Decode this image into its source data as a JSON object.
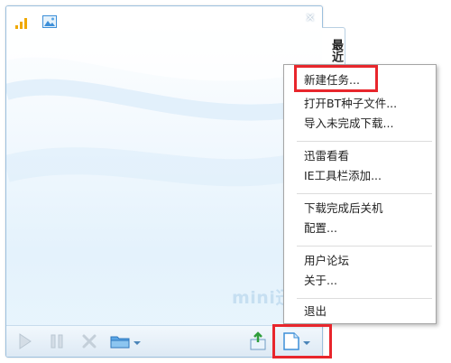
{
  "window": {
    "side_tab_label": "最近",
    "watermark_text": "mini迅"
  },
  "menu": {
    "items": [
      "新建任务...",
      "打开BT种子文件...",
      "导入未完成下载...",
      "迅雷看看",
      "IE工具栏添加...",
      "下载完成后关机",
      "配置...",
      "用户论坛",
      "关于...",
      "退出"
    ]
  },
  "colors": {
    "highlight": "#e8262c",
    "accent": "#3d8fd8",
    "signal": "#f0a800"
  }
}
